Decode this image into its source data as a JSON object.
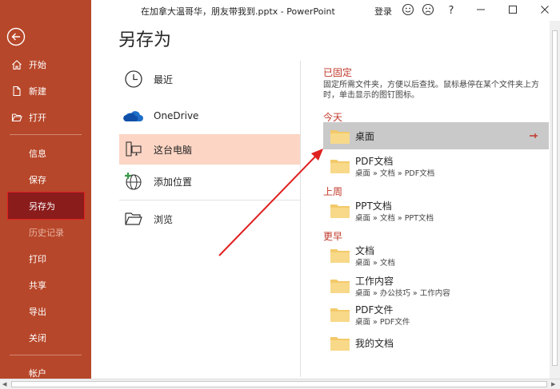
{
  "window": {
    "title": "在加拿大温哥华，朋友带我到.pptx  -  PowerPoint",
    "login": "登录"
  },
  "sidebar": {
    "items": [
      {
        "label": "开始",
        "icon": "home-icon"
      },
      {
        "label": "新建",
        "icon": "new-file-icon"
      },
      {
        "label": "打开",
        "icon": "open-folder-icon"
      },
      {
        "label": "信息"
      },
      {
        "label": "保存"
      },
      {
        "label": "另存为"
      },
      {
        "label": "历史记录"
      },
      {
        "label": "打印"
      },
      {
        "label": "共享"
      },
      {
        "label": "导出"
      },
      {
        "label": "关闭"
      },
      {
        "label": "帐户"
      }
    ]
  },
  "main": {
    "heading": "另存为",
    "locations": [
      {
        "label": "最近",
        "icon": "clock-icon"
      },
      {
        "label": "OneDrive",
        "icon": "cloud-icon"
      },
      {
        "label": "这台电脑",
        "icon": "computer-icon"
      },
      {
        "label": "添加位置",
        "icon": "globe-add-icon"
      },
      {
        "label": "浏览",
        "icon": "folder-open-icon"
      }
    ]
  },
  "right": {
    "pinned_title": "已固定",
    "pinned_desc": "固定所需文件夹，方便以后查找。鼠标悬停在某个文件夹上方时，单击显示的图钉图标。",
    "today_title": "今天",
    "lastweek_title": "上周",
    "older_title": "更早",
    "today": [
      {
        "name": "桌面",
        "path": ""
      },
      {
        "name": "PDF文档",
        "path": "桌面 » 文档 » PDF文档"
      }
    ],
    "lastweek": [
      {
        "name": "PPT文档",
        "path": "桌面 » 文档 » PPT文档"
      }
    ],
    "older": [
      {
        "name": "文档",
        "path": "桌面 » 文档"
      },
      {
        "name": "工作内容",
        "path": "桌面 » 办公技巧 » 工作内容"
      },
      {
        "name": "PDF文件",
        "path": "桌面 » PDF文件"
      },
      {
        "name": "我的文档",
        "path": ""
      }
    ]
  },
  "colors": {
    "sidebar_bg": "#b7472a",
    "active_bg": "#8b1c1c",
    "highlight_outline": "#e02020",
    "selected_location_bg": "#fcd5c4",
    "section_title": "#c0392b",
    "folder": "#f3c96a",
    "annotation_arrow": "#e02020"
  }
}
